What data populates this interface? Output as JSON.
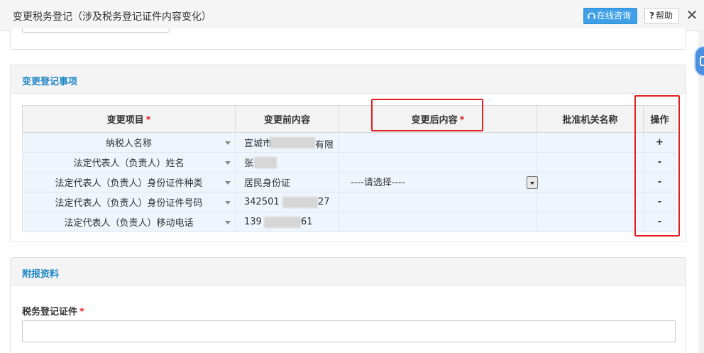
{
  "window": {
    "title": "变更税务登记（涉及税务登记证件内容变化）",
    "consult_label": "在线咨询",
    "help_q": "?",
    "help_label": "帮助",
    "close_glyph": "✕"
  },
  "change_section": {
    "title": "变更登记事项",
    "columns": {
      "item": "变更项目",
      "before": "变更前内容",
      "after": "变更后内容",
      "authority": "批准机关名称",
      "op": "操作",
      "required_mark": "*"
    },
    "rows": [
      {
        "item": "纳税人名称",
        "before_a": "宣城市",
        "before_b": "有限",
        "op": "+"
      },
      {
        "item": "法定代表人（负责人）姓名",
        "before_a": "张",
        "before_b": "",
        "op": "-"
      },
      {
        "item": "法定代表人（负责人）身份证件种类",
        "before_a": "居民身份证",
        "before_b": "",
        "after_select": "----请选择----",
        "op": "-"
      },
      {
        "item": "法定代表人（负责人）身份证件号码",
        "before_a": "342501",
        "before_b": "27",
        "op": "-"
      },
      {
        "item": "法定代表人（负责人）移动电话",
        "before_a": "139",
        "before_b": "61",
        "op": "-"
      }
    ]
  },
  "attach_section": {
    "title": "附报资料",
    "field_label": "税务登记证件",
    "required_mark": "*"
  }
}
